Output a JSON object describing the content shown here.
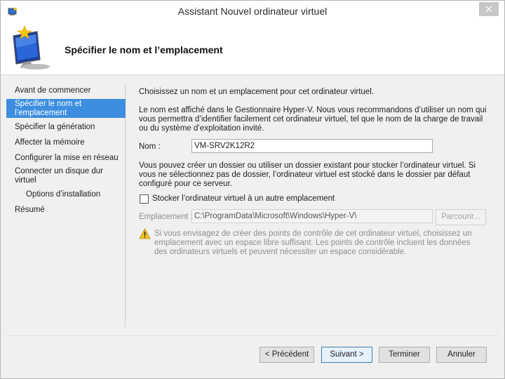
{
  "window": {
    "title": "Assistant Nouvel ordinateur virtuel",
    "close_glyph": "✕"
  },
  "header": {
    "title": "Spécifier le nom et l’emplacement"
  },
  "nav": {
    "items": [
      {
        "label": "Avant de commencer"
      },
      {
        "label": "Spécifier le nom et l’emplacement",
        "selected": true
      },
      {
        "label": "Spécifier la génération"
      },
      {
        "label": "Affecter la mémoire"
      },
      {
        "label": "Configurer la mise en réseau"
      },
      {
        "label": "Connecter un disque dur virtuel"
      },
      {
        "label": "Options d’installation"
      },
      {
        "label": "Résumé"
      }
    ]
  },
  "content": {
    "intro": "Choisissez un nom et un emplacement pour cet ordinateur virtuel.",
    "name_help": "Le nom est affiché dans le Gestionnaire Hyper-V. Nous vous recommandons d’utiliser un nom qui vous permettra d’identifier facilement cet ordinateur virtuel, tel que le nom de la charge de travail ou du système d’exploitation invité.",
    "name_label": "Nom :",
    "name_value": "VM-SRV2K12R2",
    "folder_help": "Vous pouvez créer un dossier ou utiliser un dossier existant pour stocker l’ordinateur virtuel. Si vous ne sélectionnez pas de dossier, l’ordinateur virtuel est stocké dans le dossier par défaut configuré pour ce serveur.",
    "store_checkbox_label": "Stocker l’ordinateur virtuel à un autre emplacement",
    "store_checked": false,
    "location_label": "Emplacement :",
    "location_value": "C:\\ProgramData\\Microsoft\\Windows\\Hyper-V\\",
    "browse_label": "Parcourir...",
    "warning": "Si vous envisagez de créer des points de contrôle de cet ordinateur virtuel, choisissez un emplacement avec un espace libre suffisant. Les points de contrôle incluent les données des ordinateurs virtuels et peuvent nécessiter un espace considérable."
  },
  "buttons": {
    "previous": "< Précédent",
    "next": "Suivant >",
    "finish": "Terminer",
    "cancel": "Annuler"
  },
  "icons": {
    "app": "hyper-v-app-icon",
    "header": "new-vm-monitor-icon",
    "warning": "warning-icon"
  },
  "colors": {
    "selection": "#3d8ee0",
    "default_button_border": "#3c7fb1"
  }
}
